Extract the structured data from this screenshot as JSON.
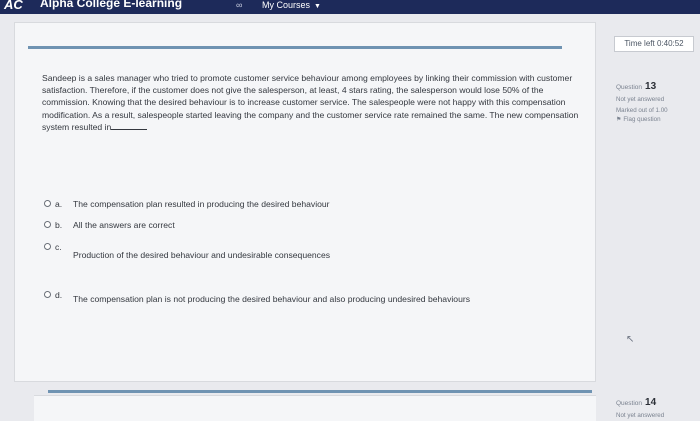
{
  "navbar": {
    "logo": "AC",
    "brand": "Alpha College E-learning",
    "link_icon": "link-icon",
    "my_courses": "My Courses"
  },
  "question": {
    "text": "Sandeep is a sales manager who tried to promote customer service behaviour among employees by linking their commission with customer satisfaction. Therefore, if the customer does not give the salesperson, at least, 4 stars rating, the salesperson would lose 50% of the commission. Knowing that the desired behaviour is to increase customer service. The salespeople were not happy with this compensation modification. As a result, salespeople started leaving the company and the customer service rate remained the same. The new compensation system resulted in",
    "answers": [
      {
        "letter": "a.",
        "text": "The compensation plan resulted in producing the desired behaviour"
      },
      {
        "letter": "b.",
        "text": "All the answers are correct"
      },
      {
        "letter": "c.",
        "text": "Production of the desired behaviour and undesirable consequences"
      },
      {
        "letter": "d.",
        "text": "The compensation plan is not producing the desired behaviour and also producing undesired behaviours"
      }
    ]
  },
  "sidebar": {
    "timer": "Time left 0:40:52",
    "current": {
      "label": "Question",
      "number": "13",
      "status": "Not yet answered",
      "marked": "Marked out of 1.00",
      "flag": "Flag question"
    },
    "next": {
      "label": "Question",
      "number": "14",
      "status": "Not yet answered"
    }
  },
  "colors": {
    "navbar": "#1d2a5a",
    "accent_line": "#6f93b2"
  }
}
